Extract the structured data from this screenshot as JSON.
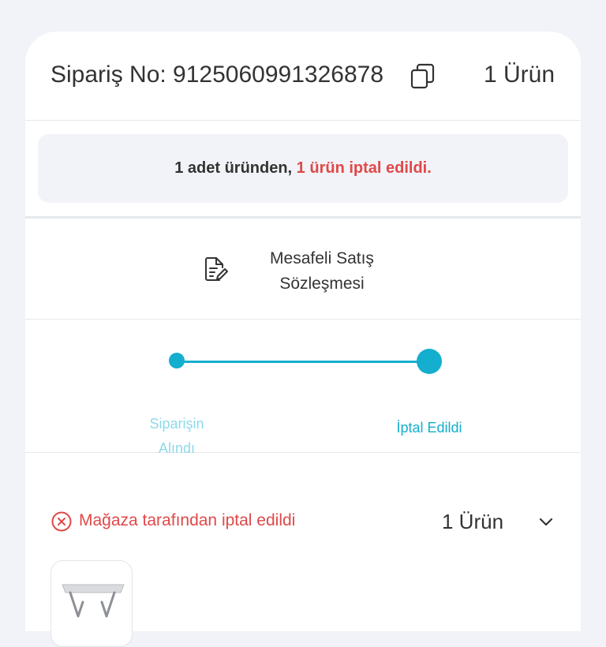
{
  "order": {
    "number_label": "Sipariş No: 9125060991326878",
    "item_count": "1 Ürün"
  },
  "cancel_notice": {
    "prefix": "1 adet üründen,",
    "highlight": "1 ürün iptal edildi."
  },
  "contract": {
    "line1": "Mesafeli Satış",
    "line2": "Sözleşmesi"
  },
  "tracker": {
    "steps": [
      {
        "line1": "Siparişin",
        "line2": "Alındı"
      },
      {
        "label": "İptal Edildi"
      }
    ]
  },
  "shipment": {
    "status": "Mağaza tarafından iptal edildi",
    "item_count": "1 Ürün"
  },
  "colors": {
    "accent": "#14aecf",
    "danger": "#e04848",
    "background": "#f1f3f8"
  }
}
